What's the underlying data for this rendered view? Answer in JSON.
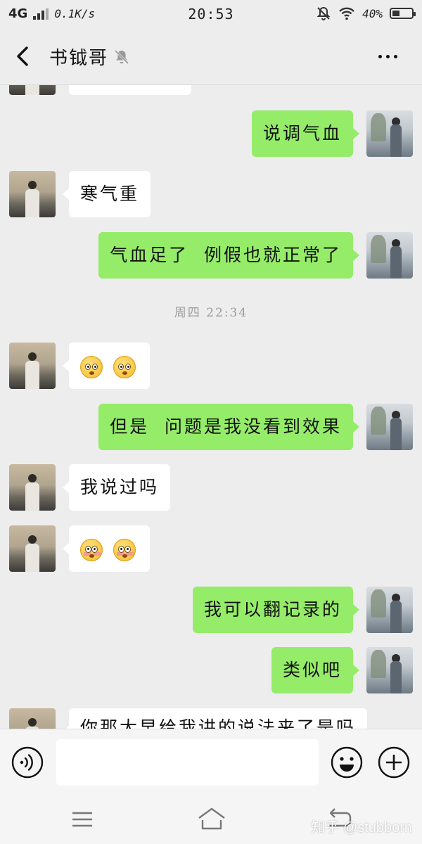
{
  "status_bar": {
    "network": "4G",
    "speed": "0.1K/s",
    "time": "20:53",
    "battery_percent": "40%",
    "battery_level": 0.4
  },
  "header": {
    "back_icon": "chevron-left-icon",
    "title": "书钺哥",
    "mute_icon": "bell-off-icon",
    "more_icon": "more-horizontal-icon"
  },
  "messages": [
    {
      "side": "in",
      "text": ""
    },
    {
      "side": "out",
      "text": "说调气血"
    },
    {
      "side": "in",
      "text": "寒气重"
    },
    {
      "side": "out",
      "text": "气血足了  例假也就正常了"
    },
    {
      "timestamp": "周四 22:34"
    },
    {
      "side": "in",
      "emoji": [
        "pleading-face",
        "pleading-face"
      ]
    },
    {
      "side": "out",
      "text": "但是  问题是我没看到效果"
    },
    {
      "side": "in",
      "text": "我说过吗"
    },
    {
      "side": "in",
      "emoji": [
        "flushed-face",
        "flushed-face"
      ]
    },
    {
      "side": "out",
      "text": "我可以翻记录的"
    },
    {
      "side": "out",
      "text": "类似吧"
    },
    {
      "side": "in",
      "text": "你那大早给我讲的说法来了是吗"
    }
  ],
  "input_bar": {
    "voice_icon": "voice-icon",
    "emoji_icon": "smiley-icon",
    "plus_icon": "plus-circle-icon",
    "value": ""
  },
  "nav_bar": {
    "menu_icon": "menu-icon",
    "home_icon": "home-icon",
    "back_icon": "return-icon",
    "watermark": "知乎 @stubborn"
  },
  "colors": {
    "background": "#ededed",
    "outgoing_bubble": "#95ec69",
    "incoming_bubble": "#ffffff"
  }
}
